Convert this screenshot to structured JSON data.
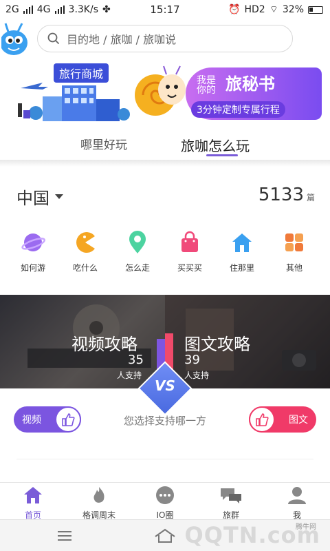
{
  "status_bar": {
    "network1": "2G",
    "network2": "4G",
    "speed": "3.3K/s",
    "time": "15:17",
    "hd": "HD2",
    "battery": "32%"
  },
  "search": {
    "placeholder": "目的地 / 旅咖 / 旅咖说"
  },
  "banner": {
    "shop_title": "旅行商城",
    "secret_prefix_1": "我是",
    "secret_prefix_2": "你的",
    "secret_title": "旅秘书",
    "secret_sub": "3分钟定制专属行程"
  },
  "tabs": [
    {
      "label": "哪里好玩",
      "active": false
    },
    {
      "label": "旅咖怎么玩",
      "active": true
    }
  ],
  "region": {
    "name": "中国",
    "count": "5133",
    "unit": "篇"
  },
  "categories": [
    {
      "label": "如何游",
      "icon": "planet-icon",
      "color": "#9b6bf0"
    },
    {
      "label": "吃什么",
      "icon": "pacman-icon",
      "color": "#f5a623"
    },
    {
      "label": "怎么走",
      "icon": "location-pin-icon",
      "color": "#4cd3a0"
    },
    {
      "label": "买买买",
      "icon": "shopping-bag-icon",
      "color": "#f04a7a"
    },
    {
      "label": "住那里",
      "icon": "house-icon",
      "color": "#3aa0f0"
    },
    {
      "label": "其他",
      "icon": "grid-icon",
      "color": "#f07a3a"
    }
  ],
  "vs": {
    "left_title": "视频攻略",
    "left_count": "35",
    "left_support": "人支持",
    "right_title": "图文攻略",
    "right_count": "39",
    "right_support": "人支持",
    "badge": "VS",
    "left_button": "视频",
    "right_button": "图文",
    "prompt": "您选择支持哪一方"
  },
  "nav": [
    {
      "label": "首页",
      "icon": "home-icon",
      "active": true
    },
    {
      "label": "格调周末",
      "icon": "flame-icon",
      "active": false
    },
    {
      "label": "IO圈",
      "icon": "chat-dots-icon",
      "active": false
    },
    {
      "label": "旅群",
      "icon": "group-chat-icon",
      "active": false
    },
    {
      "label": "我",
      "icon": "user-icon",
      "active": false
    }
  ],
  "watermark": {
    "brand": "QQTN.com",
    "small": "腾牛网"
  },
  "colors": {
    "accent": "#7a5cd8",
    "video": "#7b55e0",
    "image_text": "#f03a68"
  }
}
